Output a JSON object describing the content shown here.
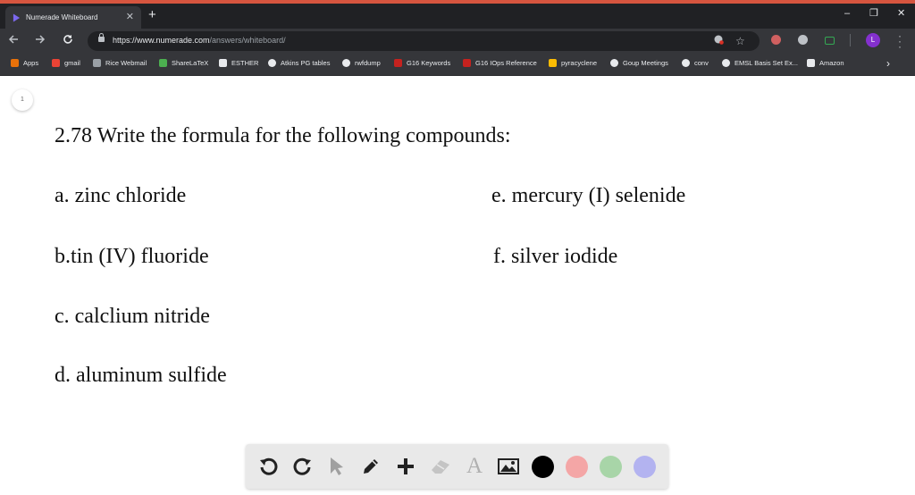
{
  "browser": {
    "tab_title": "Numerade Whiteboard",
    "tab_close": "✕",
    "new_tab": "+",
    "window_controls": {
      "minimize": "–",
      "restore": "❐",
      "close": "✕"
    },
    "url_host": "https://www.numerade.com",
    "url_path": "/answers/whiteboard/",
    "profile_initial": "L",
    "bookmarks": [
      {
        "label": "Apps",
        "icon": "apps-grid-icon",
        "color": "#e8710a"
      },
      {
        "label": "gmail",
        "icon": "gmail-icon",
        "color": "#ea4335"
      },
      {
        "label": "Rice Webmail",
        "icon": "webmail-icon",
        "color": "#9aa0a6"
      },
      {
        "label": "ShareLaTeX",
        "icon": "sharelatex-icon",
        "color": "#4caf50"
      },
      {
        "label": "ESTHER",
        "icon": "document-icon",
        "color": "#e8eaed"
      },
      {
        "label": "Atkins PG tables",
        "icon": "github-icon",
        "color": "#e8eaed"
      },
      {
        "label": "rwfdump",
        "icon": "github-icon",
        "color": "#e8eaed"
      },
      {
        "label": "G16 Keywords",
        "icon": "gaussian-icon",
        "color": "#c5221f"
      },
      {
        "label": "G16 IOps Reference",
        "icon": "gaussian-icon",
        "color": "#c5221f"
      },
      {
        "label": "pyracyclene",
        "icon": "folder-icon",
        "color": "#fbbc04"
      },
      {
        "label": "Goup Meetings",
        "icon": "github-icon",
        "color": "#e8eaed"
      },
      {
        "label": "conv",
        "icon": "github-icon",
        "color": "#e8eaed"
      },
      {
        "label": "EMSL Basis Set Ex...",
        "icon": "github-icon",
        "color": "#e8eaed"
      },
      {
        "label": "Amazon",
        "icon": "amazon-icon",
        "color": "#e8eaed"
      }
    ]
  },
  "whiteboard": {
    "page_indicator": "1",
    "question": "2.78 Write the formula for the following compounds:",
    "items": {
      "a": "a. zinc chloride",
      "b": "b.tin (IV) fluoride",
      "c": "c. calclium nitride",
      "d": "d. aluminum sulfide",
      "e": "e. mercury (I) selenide",
      "f": "f. silver iodide"
    },
    "text_tool_label": "A",
    "colors": {
      "black": "#000000",
      "red": "#f4a6a6",
      "green": "#a8d5a8",
      "purple": "#b3b3f0"
    }
  }
}
